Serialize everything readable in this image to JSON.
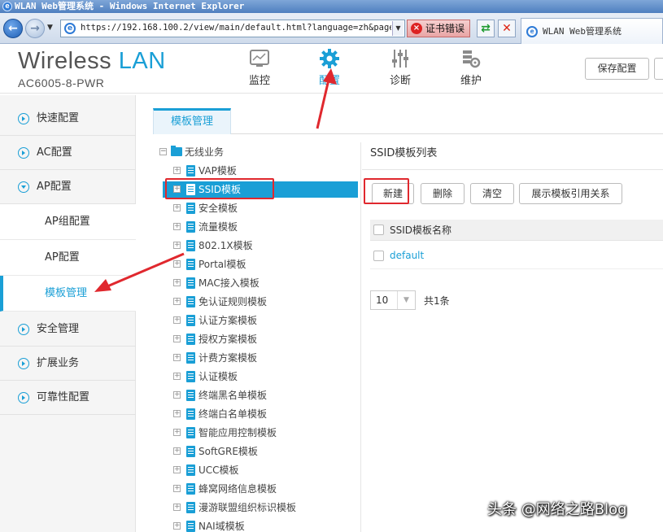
{
  "browser": {
    "window_title": "WLAN Web管理系统 - Windows Internet Explorer",
    "url": "https://192.168.100.2/view/main/default.html?language=zh&page",
    "cert_error": "证书错误",
    "tab_title": "WLAN Web管理系统"
  },
  "header": {
    "brand_main": "Wireless",
    "brand_accent": "LAN",
    "model": "AC6005-8-PWR",
    "nav": [
      {
        "label": "监控",
        "icon": "monitor-icon"
      },
      {
        "label": "配置",
        "icon": "gear-icon",
        "active": true
      },
      {
        "label": "诊断",
        "icon": "sliders-icon"
      },
      {
        "label": "维护",
        "icon": "maintenance-icon"
      }
    ],
    "save_label": "保存配置"
  },
  "sidebar": {
    "items": [
      {
        "label": "快速配置"
      },
      {
        "label": "AC配置"
      },
      {
        "label": "AP配置",
        "expanded": true
      },
      {
        "label": "安全管理"
      },
      {
        "label": "扩展业务"
      },
      {
        "label": "可靠性配置"
      }
    ],
    "sub_items": [
      {
        "label": "AP组配置"
      },
      {
        "label": "AP配置"
      },
      {
        "label": "模板管理",
        "active": true
      }
    ]
  },
  "content": {
    "tab": "模板管理",
    "tree_root": "无线业务",
    "tree_nodes": [
      "VAP模板",
      "SSID模板",
      "安全模板",
      "流量模板",
      "802.1X模板",
      "Portal模板",
      "MAC接入模板",
      "免认证规则模板",
      "认证方案模板",
      "授权方案模板",
      "计费方案模板",
      "认证模板",
      "终端黑名单模板",
      "终端白名单模板",
      "智能应用控制模板",
      "SoftGRE模板",
      "UCC模板",
      "蜂窝网络信息模板",
      "漫游联盟组织标识模板",
      "NAI域模板"
    ],
    "selected_node": "SSID模板",
    "list_title": "SSID模板列表",
    "buttons": {
      "new": "新建",
      "delete": "删除",
      "clear": "清空",
      "show_relations": "展示模板引用关系"
    },
    "grid_header": "SSID模板名称",
    "rows": [
      "default"
    ],
    "page_size": "10",
    "total": "共1条"
  },
  "colors": {
    "accent": "#1a9fd6",
    "highlight": "#e0282e"
  },
  "watermark": "头条 @网络之路Blog"
}
